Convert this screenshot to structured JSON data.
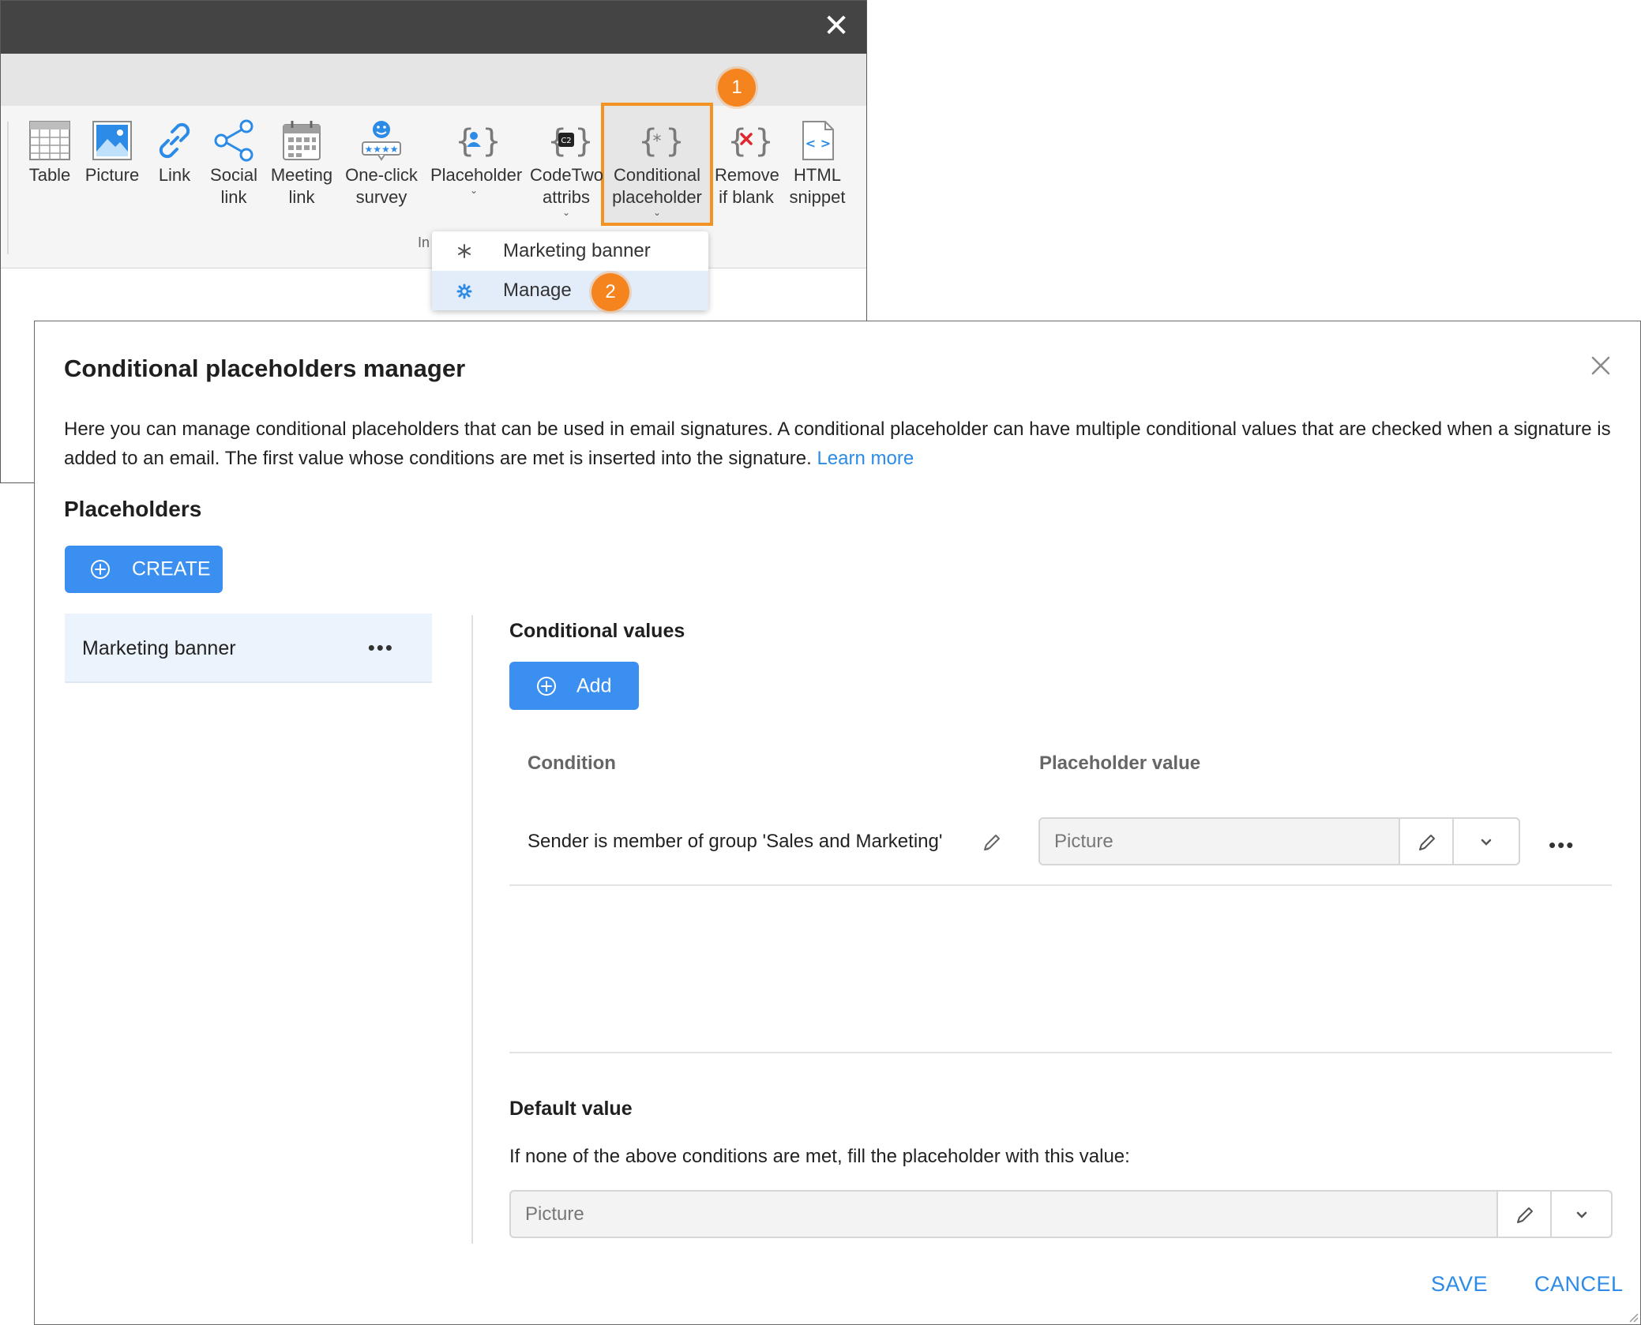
{
  "ribbon": {
    "buttons": [
      {
        "label": "Table",
        "label2": ""
      },
      {
        "label": "Picture",
        "label2": ""
      },
      {
        "label": "Link",
        "label2": ""
      },
      {
        "label": "Social",
        "label2": "link"
      },
      {
        "label": "Meeting",
        "label2": "link"
      },
      {
        "label": "One-click",
        "label2": "survey"
      },
      {
        "label": "Placeholder",
        "label2": ""
      },
      {
        "label": "CodeTwo",
        "label2": "attribs"
      },
      {
        "label": "Conditional",
        "label2": "placeholder"
      },
      {
        "label": "Remove",
        "label2": "if blank"
      },
      {
        "label": "HTML",
        "label2": "snippet"
      }
    ],
    "group_label": "In",
    "highlight_color": "#f39324"
  },
  "badges": {
    "step1": "1",
    "step2": "2",
    "color": "#f5841f"
  },
  "dropdown": {
    "items": [
      {
        "label": "Marketing banner",
        "icon": "asterisk-icon"
      },
      {
        "label": "Manage",
        "icon": "gear-icon"
      }
    ]
  },
  "dialog": {
    "title": "Conditional placeholders manager",
    "description": "Here you can manage conditional placeholders that can be used in email signatures. A conditional placeholder can have multiple conditional values that are checked when a signature is added to an email. The first value whose conditions are met is inserted into the signature.",
    "learn_more": "Learn more",
    "placeholders_heading": "Placeholders",
    "create_label": "CREATE",
    "placeholders": [
      {
        "name": "Marketing banner"
      }
    ],
    "conditional_values_heading": "Conditional values",
    "add_label": "Add",
    "columns": {
      "condition": "Condition",
      "value": "Placeholder value"
    },
    "rows": [
      {
        "condition": "Sender is member of group 'Sales and Marketing'",
        "value": "Picture"
      }
    ],
    "default_heading": "Default value",
    "default_text": "If none of the above conditions are met, fill the placeholder with this value:",
    "default_value": "Picture",
    "save_label": "SAVE",
    "cancel_label": "CANCEL",
    "accent_color": "#3b8ff0"
  }
}
